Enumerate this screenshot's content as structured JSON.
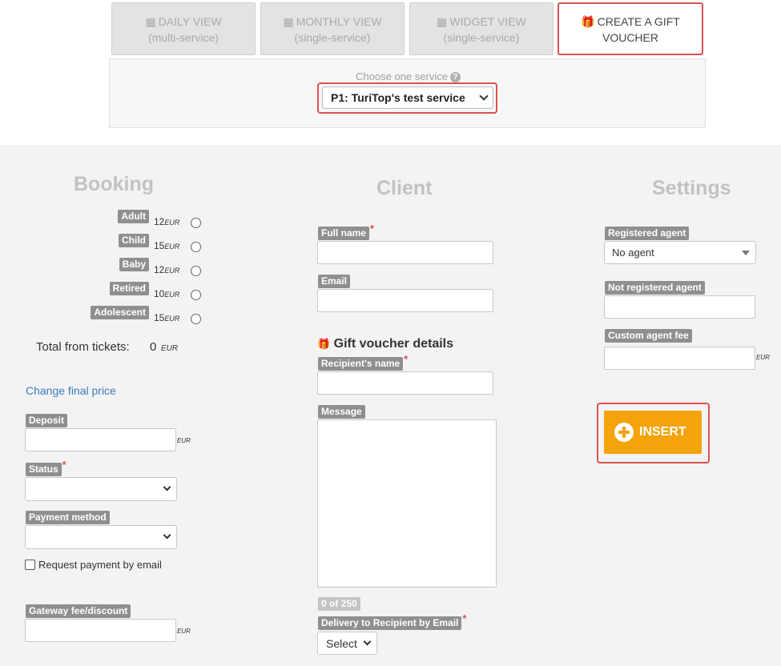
{
  "tabs": [
    {
      "label": "DAILY VIEW",
      "sub": "(multi-service)",
      "icon": "calendar-icon"
    },
    {
      "label": "MONTHLY VIEW",
      "sub": "(single-service)",
      "icon": "calendar-icon"
    },
    {
      "label": "WIDGET VIEW",
      "sub": "(single-service)",
      "icon": "calendar-icon"
    },
    {
      "label": "CREATE A GIFT",
      "sub": "VOUCHER",
      "icon": "gift-icon"
    }
  ],
  "service": {
    "label": "Choose one service",
    "help": "?",
    "selected": "P1: TuriTop's test service"
  },
  "booking": {
    "title": "Booking",
    "tickets": [
      {
        "name": "Adult",
        "price": "12",
        "currency": "EUR"
      },
      {
        "name": "Child",
        "price": "15",
        "currency": "EUR"
      },
      {
        "name": "Baby",
        "price": "12",
        "currency": "EUR"
      },
      {
        "name": "Retired",
        "price": "10",
        "currency": "EUR"
      },
      {
        "name": "Adolescent",
        "price": "15",
        "currency": "EUR"
      }
    ],
    "total_label": "Total from tickets:",
    "total_value": "0",
    "total_currency": "EUR",
    "change_price": "Change final price",
    "deposit_label": "Deposit",
    "deposit_value": "",
    "deposit_currency": "EUR",
    "status_label": "Status",
    "status_value": "",
    "payment_label": "Payment method",
    "payment_value": "",
    "request_email_label": "Request payment by email",
    "gateway_label": "Gateway fee/discount",
    "gateway_value": "",
    "gateway_currency": "EUR"
  },
  "client": {
    "title": "Client",
    "fullname_label": "Full name",
    "fullname_value": "",
    "email_label": "Email",
    "email_value": "",
    "voucher_title": "Gift voucher details",
    "recipient_label": "Recipient's name",
    "recipient_value": "",
    "message_label": "Message",
    "message_value": "",
    "counter": "0 of 250",
    "delivery_label": "Delivery to Recipient by Email",
    "delivery_value": "Select"
  },
  "settings": {
    "title": "Settings",
    "registered_label": "Registered agent",
    "registered_value": "No agent",
    "not_registered_label": "Not registered agent",
    "not_registered_value": "",
    "fee_label": "Custom agent fee",
    "fee_value": "",
    "fee_currency": "EUR",
    "insert_label": "INSERT"
  },
  "colors": {
    "accent": "#f4a30b",
    "highlight": "#d9534f",
    "link": "#3a7bbf",
    "tag": "#8f8f8f"
  }
}
